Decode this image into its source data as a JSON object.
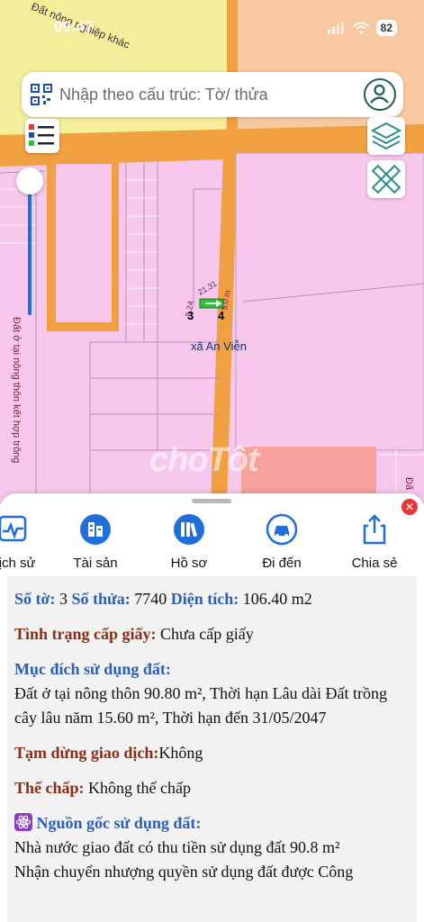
{
  "status": {
    "time": "09:47",
    "battery": "82"
  },
  "search": {
    "placeholder": "Nhập theo cấu trúc: Tờ/ thửa"
  },
  "map": {
    "label_top": "Đất nông nghiệp khác",
    "label_left": "Đất ở tại nông thôn kết hợp trồng",
    "label_right": "Đấ",
    "place_name": "xã An Viễn",
    "parcel_left": "3",
    "parcel_right": "4",
    "watermark": "choTốt"
  },
  "actions": [
    {
      "label": "Lịch sử",
      "icon": "history-icon"
    },
    {
      "label": "Tài sản",
      "icon": "buildings-icon"
    },
    {
      "label": "Hồ sơ",
      "icon": "books-icon"
    },
    {
      "label": "Đi đến",
      "icon": "car-icon"
    },
    {
      "label": "Chia sẻ",
      "icon": "share-icon"
    }
  ],
  "info": {
    "so_to_label": "Số tờ:",
    "so_to_value": "3",
    "so_thua_label": "Số thửa:",
    "so_thua_value": "7740",
    "dien_tich_label": "Diện tích:",
    "dien_tich_value": "106.40 m2",
    "cap_giay_label": "Tình trạng cấp giấy:",
    "cap_giay_value": "Chưa cấp giấy",
    "muc_dich_label": "Mục đích sử dụng đất:",
    "muc_dich_value": "Đất ở tại nông thôn 90.80 m², Thời hạn Lâu dài Đất trồng cây lâu năm 15.60 m², Thời hạn đến 31/05/2047",
    "tam_dung_label": "Tạm dừng giao dịch:",
    "tam_dung_value": "Không",
    "the_chap_label": "Thế chấp:",
    "the_chap_value": "Không thế chấp",
    "nguon_goc_label": "Nguồn gốc sử dụng đất:",
    "nguon_goc_line1": "Nhà nước giao đất có thu tiền sử dụng đất 90.8 m²",
    "nguon_goc_line2": "Nhận chuyển nhượng quyền sử dụng đất được Công"
  },
  "colors": {
    "accent_blue": "#2c5fb8",
    "label_brown": "#8b2d12",
    "road": "#f0a040",
    "parcel_pink": "#f7c8ec"
  }
}
